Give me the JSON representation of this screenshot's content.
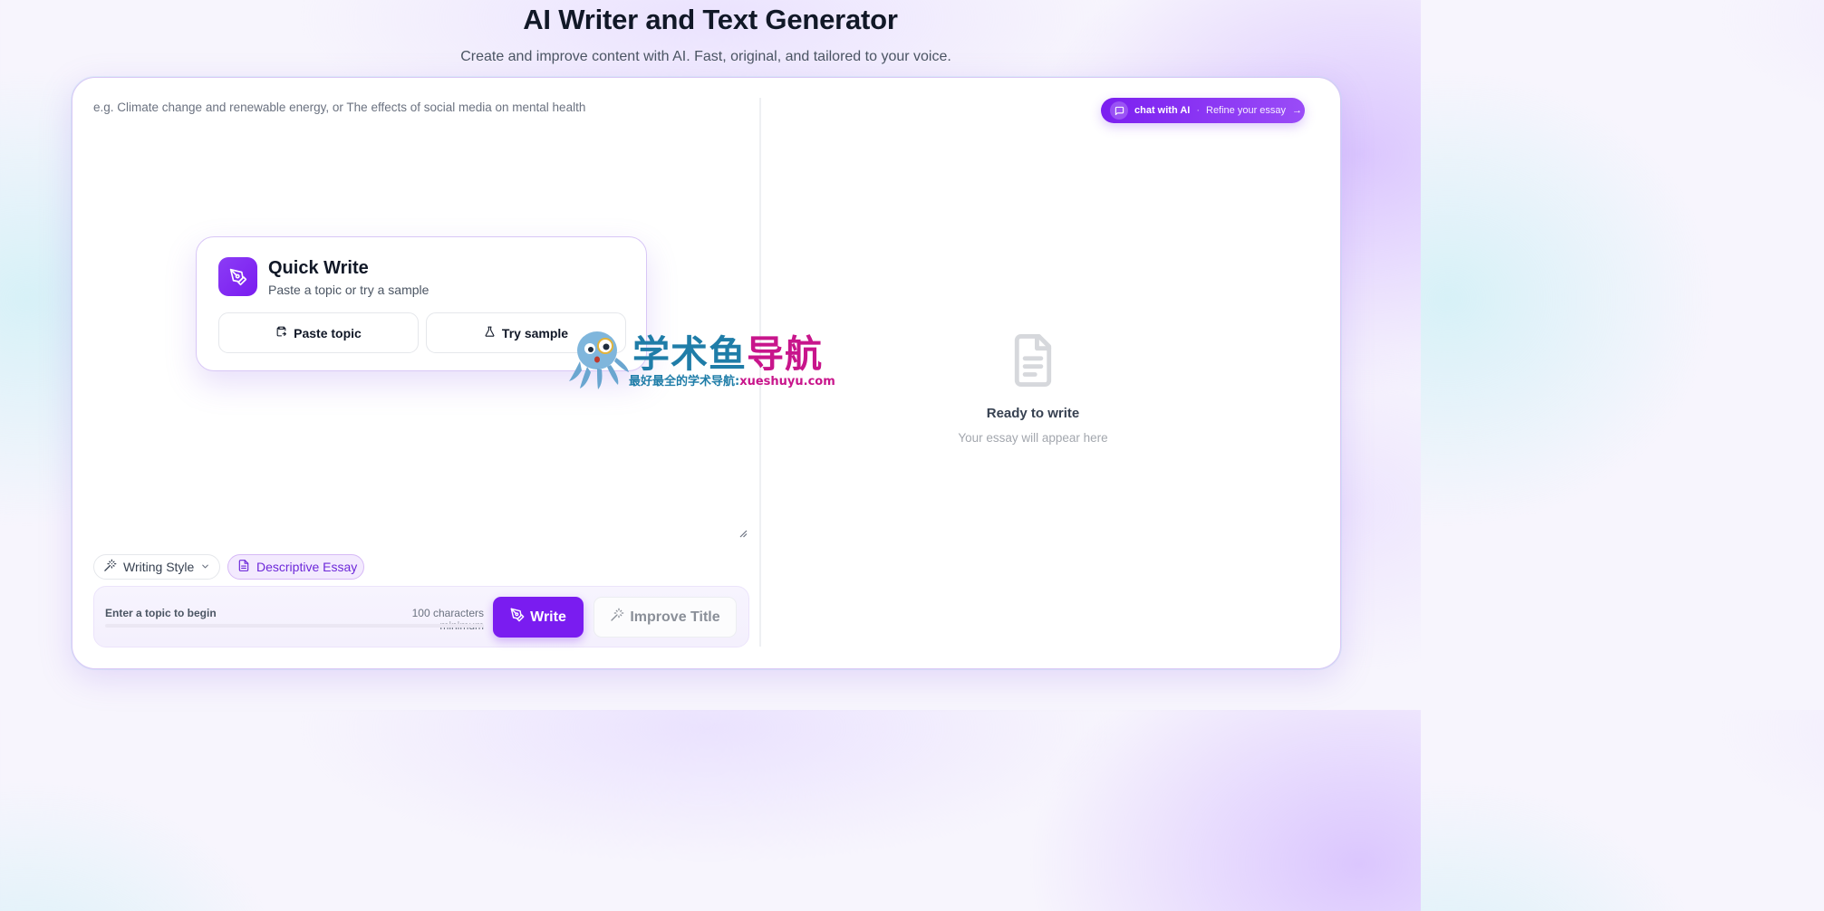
{
  "header": {
    "title": "AI Writer and Text Generator",
    "subtitle": "Create and improve content with AI. Fast, original, and tailored to your voice."
  },
  "editor": {
    "placeholder": "e.g. Climate change and renewable energy, or The effects of social media on mental health"
  },
  "quick_write": {
    "title": "Quick Write",
    "subtitle": "Paste a topic or try a sample",
    "paste_label": "Paste topic",
    "sample_label": "Try sample"
  },
  "chat_pill": {
    "label": "chat with AI",
    "separator": "·",
    "action": "Refine your essay",
    "arrow": "→"
  },
  "output": {
    "title": "Ready to write",
    "subtitle": "Your essay will appear here"
  },
  "chips": {
    "style_label": "Writing Style",
    "essay_label": "Descriptive Essay"
  },
  "bottom": {
    "status": "Enter a topic to begin",
    "min_chars": "100 characters minimum",
    "progress_percent": 0,
    "write_label": "Write",
    "improve_label": "Improve Title"
  },
  "watermark": {
    "title_a": "学术鱼",
    "title_b": "导航",
    "sub_a": "最好最全的学术导航:",
    "sub_b": "xueshuyu.com"
  },
  "colors": {
    "accent": "#7a1cf0",
    "watermark_blue": "#1f7da8",
    "watermark_magenta": "#c8158b"
  }
}
